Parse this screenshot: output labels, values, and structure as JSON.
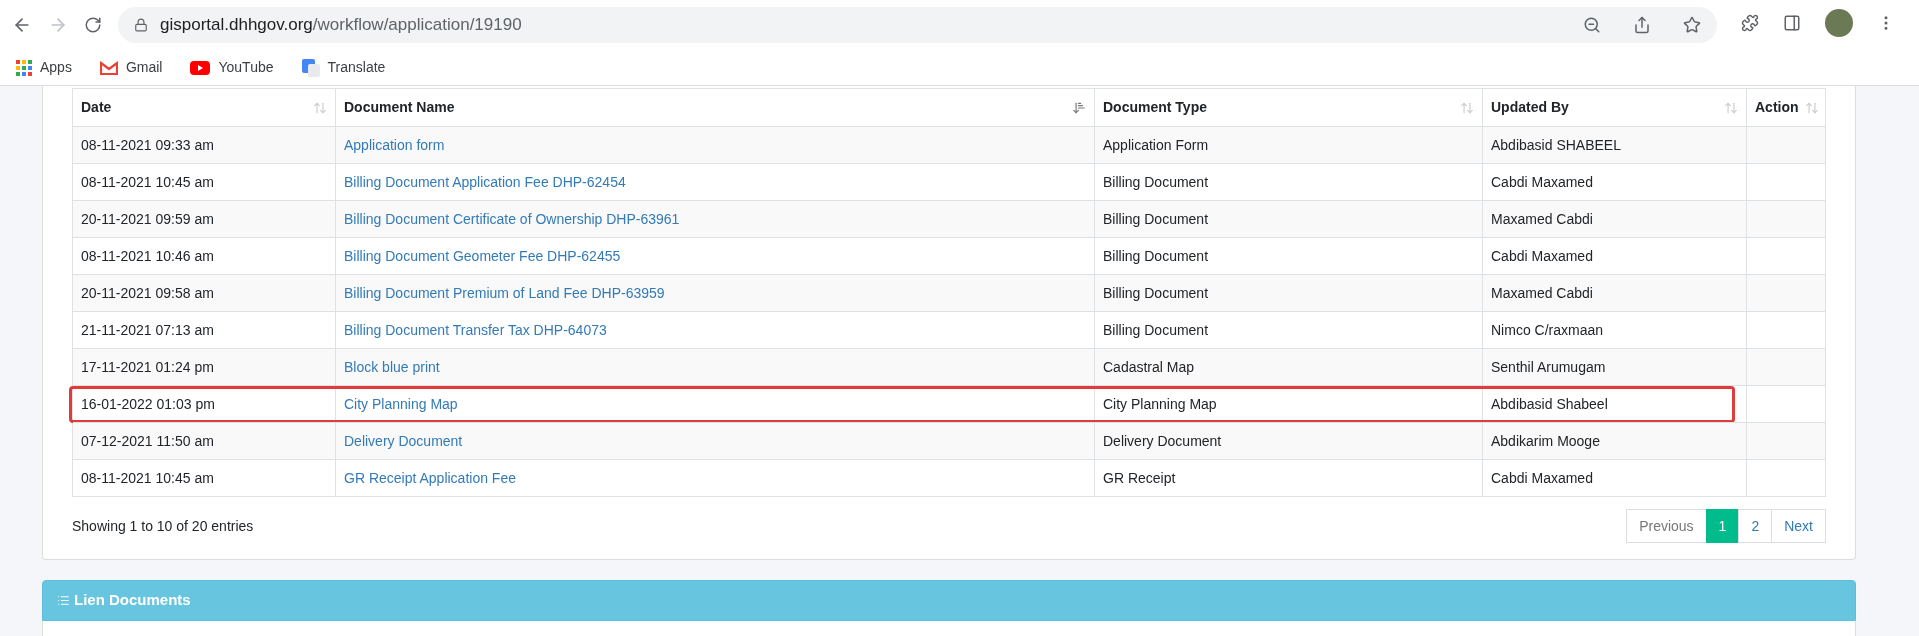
{
  "browser": {
    "url_host": "gisportal.dhhgov.org",
    "url_path": "/workflow/application/19190",
    "bookmarks": [
      {
        "label": "Apps",
        "kind": "apps"
      },
      {
        "label": "Gmail",
        "kind": "gmail"
      },
      {
        "label": "YouTube",
        "kind": "youtube"
      },
      {
        "label": "Translate",
        "kind": "translate"
      }
    ]
  },
  "table": {
    "columns": [
      {
        "label": "Date",
        "sorted": false
      },
      {
        "label": "Document Name",
        "sorted": true
      },
      {
        "label": "Document Type",
        "sorted": false
      },
      {
        "label": "Updated By",
        "sorted": false
      },
      {
        "label": "Action",
        "sorted": false
      }
    ],
    "rows": [
      {
        "date": "08-11-2021 09:33 am",
        "name": "Application form",
        "type": "Application Form",
        "updated_by": "Abdibasid SHABEEL",
        "highlighted": false
      },
      {
        "date": "08-11-2021 10:45 am",
        "name": "Billing Document Application Fee DHP-62454",
        "type": "Billing Document",
        "updated_by": "Cabdi Maxamed",
        "highlighted": false
      },
      {
        "date": "20-11-2021 09:59 am",
        "name": "Billing Document Certificate of Ownership DHP-63961",
        "type": "Billing Document",
        "updated_by": "Maxamed Cabdi",
        "highlighted": false
      },
      {
        "date": "08-11-2021 10:46 am",
        "name": "Billing Document Geometer Fee DHP-62455",
        "type": "Billing Document",
        "updated_by": "Cabdi Maxamed",
        "highlighted": false
      },
      {
        "date": "20-11-2021 09:58 am",
        "name": "Billing Document Premium of Land Fee DHP-63959",
        "type": "Billing Document",
        "updated_by": "Maxamed Cabdi",
        "highlighted": false
      },
      {
        "date": "21-11-2021 07:13 am",
        "name": "Billing Document Transfer Tax DHP-64073",
        "type": "Billing Document",
        "updated_by": "Nimco C/raxmaan",
        "highlighted": false
      },
      {
        "date": "17-11-2021 01:24 pm",
        "name": "Block blue print",
        "type": "Cadastral Map",
        "updated_by": "Senthil Arumugam",
        "highlighted": false
      },
      {
        "date": "16-01-2022 01:03 pm",
        "name": "City Planning Map",
        "type": "City Planning Map",
        "updated_by": "Abdibasid Shabeel",
        "highlighted": true
      },
      {
        "date": "07-12-2021 11:50 am",
        "name": "Delivery Document",
        "type": "Delivery Document",
        "updated_by": "Abdikarim Mooge",
        "highlighted": false
      },
      {
        "date": "08-11-2021 10:45 am",
        "name": "GR Receipt Application Fee",
        "type": "GR Receipt",
        "updated_by": "Cabdi Maxamed",
        "highlighted": false
      }
    ],
    "info": "Showing 1 to 10 of 20 entries",
    "pagination": [
      {
        "label": "Previous",
        "kind": "prev",
        "selected": false
      },
      {
        "label": "1",
        "kind": "page",
        "selected": true
      },
      {
        "label": "2",
        "kind": "page",
        "selected": false
      },
      {
        "label": "Next",
        "kind": "next",
        "selected": false
      }
    ]
  },
  "lien_panel": {
    "title": "Lien Documents"
  }
}
